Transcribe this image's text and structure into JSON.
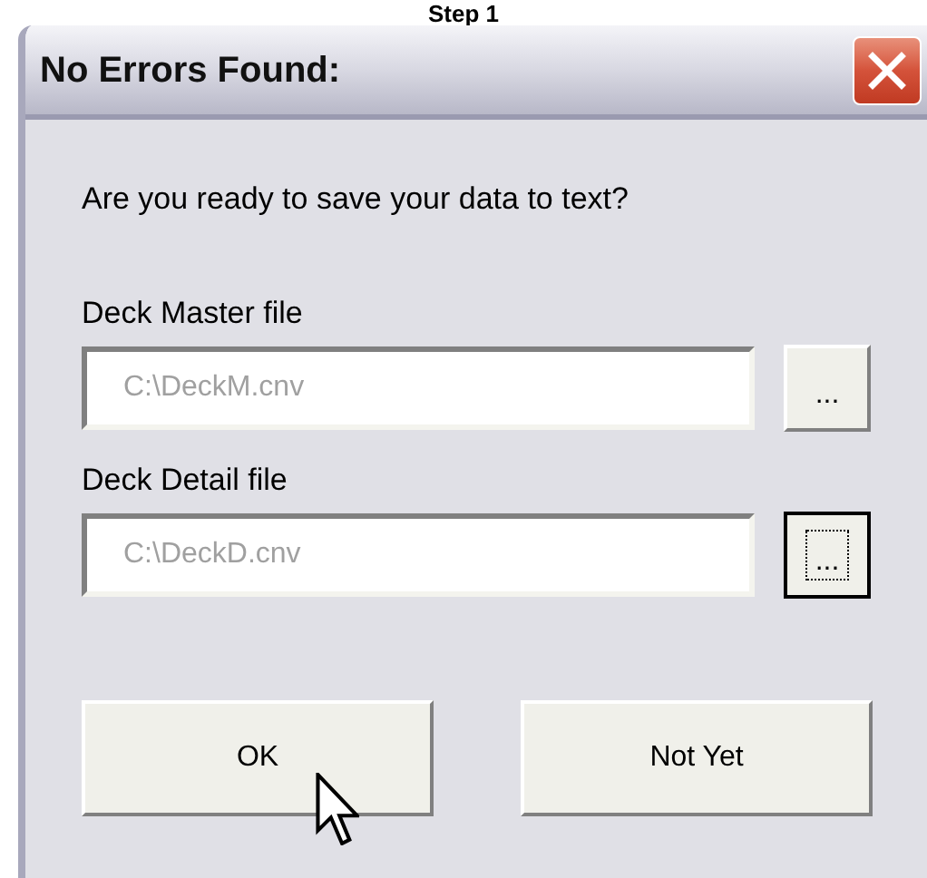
{
  "caption": "Step 1",
  "window": {
    "title": "No Errors Found:"
  },
  "prompt": "Are you ready to save your data to text?",
  "files": [
    {
      "label": "Deck Master file",
      "value": "C:\\DeckM.cnv",
      "disabled": true,
      "browse": {
        "label": "...",
        "focused": false
      }
    },
    {
      "label": "Deck Detail file",
      "value": "C:\\DeckD.cnv",
      "disabled": true,
      "browse": {
        "label": "...",
        "focused": true
      }
    }
  ],
  "buttons": [
    {
      "label": "OK"
    },
    {
      "label": "Not Yet"
    }
  ]
}
